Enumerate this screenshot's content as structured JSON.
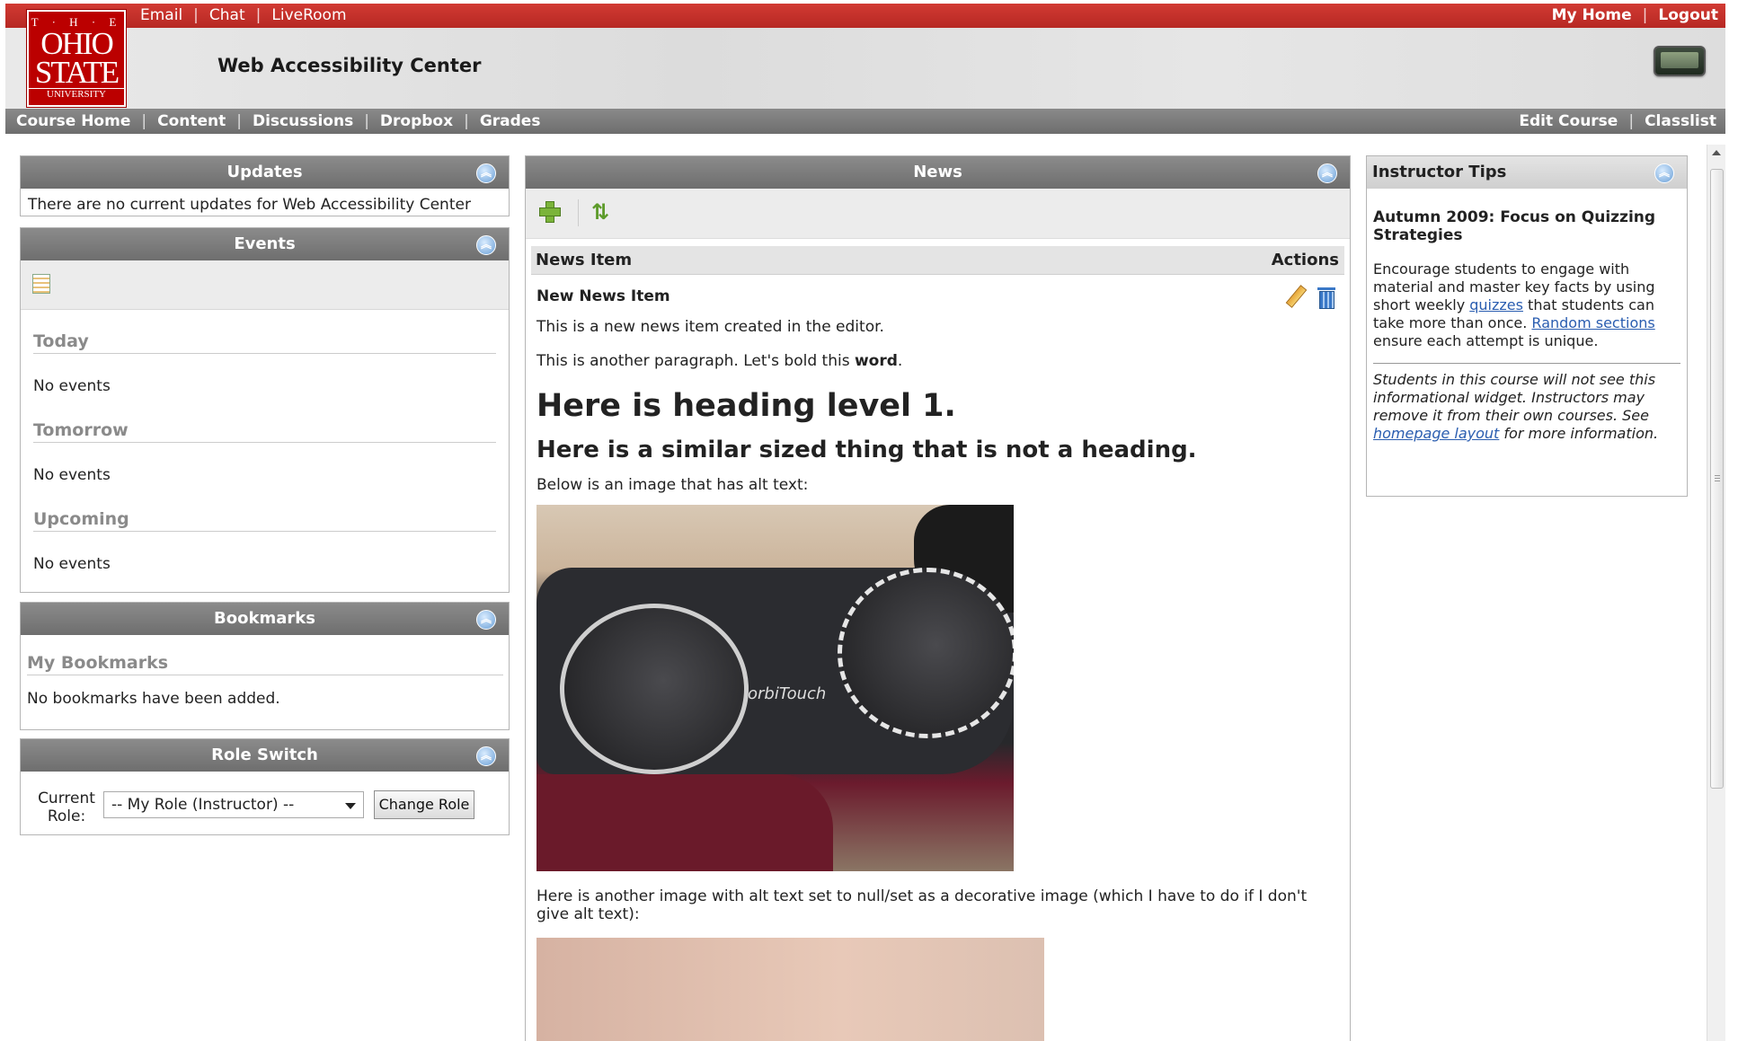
{
  "header": {
    "top_links_left": [
      "Email",
      "Chat",
      "LiveRoom"
    ],
    "top_links_right": [
      "My Home",
      "Logout"
    ],
    "logo": {
      "line1": "T · H · E",
      "line2": "OHIO",
      "line3": "STATE",
      "line4": "UNIVERSITY"
    },
    "site_title": "Web Accessibility Center",
    "accent_color": "#c9302c"
  },
  "course_nav": {
    "left": [
      "Course Home",
      "Content",
      "Discussions",
      "Dropbox",
      "Grades"
    ],
    "right": [
      "Edit Course",
      "Classlist"
    ]
  },
  "updates": {
    "title": "Updates",
    "text": "There are no current updates for Web Accessibility Center"
  },
  "events": {
    "title": "Events",
    "sections": [
      {
        "heading": "Today",
        "text": "No events"
      },
      {
        "heading": "Tomorrow",
        "text": "No events"
      },
      {
        "heading": "Upcoming",
        "text": "No events"
      }
    ]
  },
  "bookmarks": {
    "title": "Bookmarks",
    "heading": "My Bookmarks",
    "text": "No bookmarks have been added."
  },
  "role_switch": {
    "title": "Role Switch",
    "label": "Current Role:",
    "selected": "-- My Role (Instructor) --",
    "button": "Change Role"
  },
  "news": {
    "title": "News",
    "col_item": "News Item",
    "col_actions": "Actions",
    "item": {
      "title": "New News Item",
      "p1": "This is a new news item created in the editor.",
      "p2_prefix": "This is another paragraph. Let's bold this ",
      "p2_bold": "word",
      "p2_suffix": ".",
      "h1": "Here is heading level 1.",
      "fake_heading": "Here is a similar sized thing that is not a heading.",
      "p3": "Below is an image that has alt text:",
      "image1_brand": "orbiTouch",
      "p4": "Here is another image with alt text set to null/set as a decorative image (which I have to do if I don't give alt text):"
    }
  },
  "tips": {
    "title": "Instructor Tips",
    "heading": "Autumn 2009: Focus on Quizzing Strategies",
    "t1": "Encourage students to engage with material and master key facts by using short weekly ",
    "link_quizzes": "quizzes",
    "t2": " that students can take more than once. ",
    "link_random": "Random sections",
    "t3": " ensure each attempt is unique.",
    "note1": "Students in this course will not see this informational widget. Instructors may remove it from their own courses. See ",
    "link_layout": "homepage layout",
    "note2": " for more information."
  }
}
